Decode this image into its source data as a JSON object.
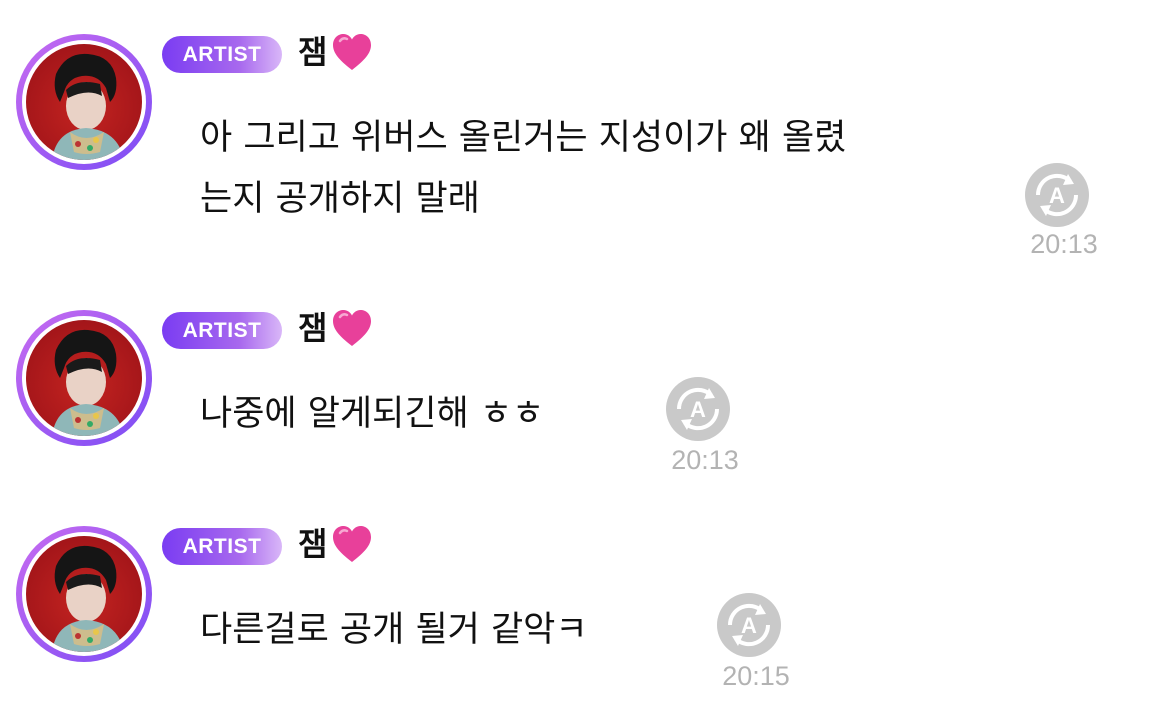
{
  "messages": [
    {
      "badge": "ARTIST",
      "author": "잼",
      "lines": [
        "아 그리고 위버스 올린거는 지성이가 왜 올렸",
        "는지 공개하지 말래"
      ],
      "time": "20:13",
      "translate_icon": "translate-icon"
    },
    {
      "badge": "ARTIST",
      "author": "잼",
      "lines": [
        "나중에 알게되긴해 ㅎㅎ"
      ],
      "time": "20:13",
      "translate_icon": "translate-icon"
    },
    {
      "badge": "ARTIST",
      "author": "잼",
      "lines": [
        "다른걸로 공개 될거 같악ㅋ"
      ],
      "time": "20:15",
      "translate_icon": "translate-icon"
    }
  ],
  "colors": {
    "badge_gradient_start": "#7a3cf2",
    "badge_gradient_end": "#d9b7f8",
    "avatar_ring": "#a65cf0",
    "timestamp": "#b3b3b3",
    "heart": "#e8409a"
  }
}
